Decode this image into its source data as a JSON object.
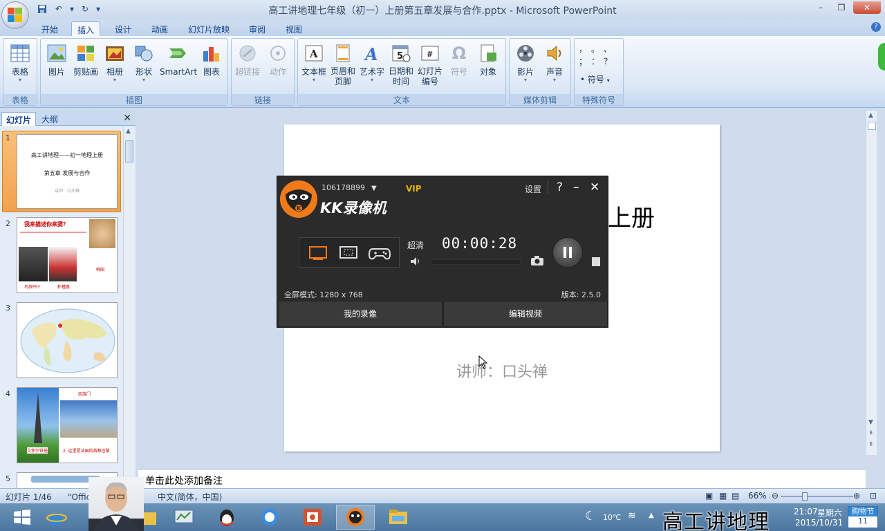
{
  "window": {
    "title": "高工讲地理七年级（初一）上册第五章发展与合作.pptx - Microsoft PowerPoint"
  },
  "ribbon_tabs": [
    "开始",
    "插入",
    "设计",
    "动画",
    "幻灯片放映",
    "审阅",
    "视图"
  ],
  "active_tab": "插入",
  "ribbon_groups": {
    "tables": {
      "label": "表格",
      "buttons": [
        "表格"
      ]
    },
    "illustrations": {
      "label": "插图",
      "buttons": [
        "图片",
        "剪贴画",
        "相册",
        "形状",
        "SmartArt",
        "图表"
      ]
    },
    "links": {
      "label": "链接",
      "buttons": [
        "超链接",
        "动作"
      ]
    },
    "text": {
      "label": "文本",
      "buttons": [
        "文本框",
        "页眉和\n页脚",
        "艺术字",
        "日期和\n时间",
        "幻灯片\n编号",
        "符号",
        "对象"
      ]
    },
    "media": {
      "label": "媒体剪辑",
      "buttons": [
        "影片",
        "声音"
      ]
    },
    "special": {
      "label": "特殊符号",
      "symbols": [
        "，",
        "。",
        "、",
        "；",
        "：",
        "？"
      ],
      "symbol_button": "符号"
    }
  },
  "panel": {
    "tabs": [
      "幻灯片",
      "大纲"
    ],
    "thumbnails": [
      {
        "num": "1",
        "lines": [
          "高工讲地理——初一地理上册",
          "第五章 发展与合作",
          "讲师：口头禅"
        ]
      },
      {
        "num": "2",
        "lines": [
          "我来描述你来猜？",
          "鸟叔PSY",
          "朴槿惠",
          "韩国"
        ]
      },
      {
        "num": "3",
        "lines": []
      },
      {
        "num": "4",
        "lines": [
          "凯旋门",
          "艾菲尔铁塔",
          "2. 这里是法国的首都巴黎"
        ]
      },
      {
        "num": "5",
        "lines": []
      }
    ]
  },
  "slide": {
    "title": "高工讲地理——初一地理上册",
    "subtitle": "第五章 发展与合作",
    "presenter": "讲师：口头禅"
  },
  "notes": {
    "placeholder": "单击此处添加备注"
  },
  "statusbar": {
    "slide_count": "幻灯片 1/46",
    "theme": "\"Office 主题\"",
    "language": "中文(简体，中国)",
    "zoom": "66%"
  },
  "kk_recorder": {
    "user_id": "106178899",
    "vip": "VIP",
    "title": "KK录像机",
    "settings": "设置",
    "quality": "超清",
    "timer": "00:00:28",
    "mode_text": "全屏模式: 1280 x 768",
    "version": "版本: 2.5.0",
    "my_recordings": "我的录像",
    "edit_video": "编辑视频"
  },
  "taskbar": {
    "weather": "10℃",
    "time": "21:07",
    "weekday": "星期六",
    "date": "2015/10/31",
    "cart_label": "购物节",
    "cart_count": "11"
  },
  "watermark": "高工讲地理",
  "colors": {
    "accent": "#f07a1a",
    "ribbon": "#dbe7f5",
    "kk_bg": "#2b2b2b"
  }
}
